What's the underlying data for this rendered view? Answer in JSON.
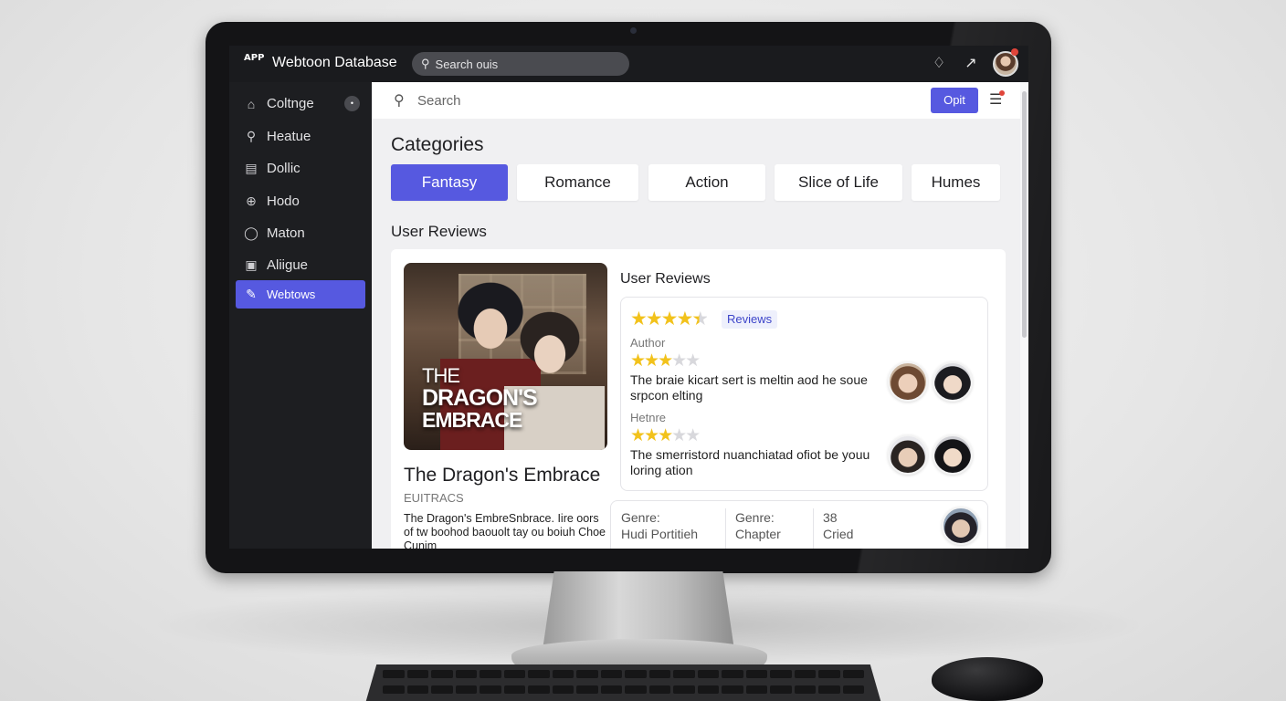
{
  "app": {
    "logo_text": "APP",
    "title": "Webtoon Database",
    "search_placeholder": "Search ouis"
  },
  "sidebar": {
    "items": [
      {
        "label": "Coltnge",
        "icon": "home-icon",
        "badge": "•"
      },
      {
        "label": "Heatue",
        "icon": "search-icon"
      },
      {
        "label": "Dollic",
        "icon": "document-icon"
      },
      {
        "label": "Hodo",
        "icon": "zoom-icon"
      },
      {
        "label": "Maton",
        "icon": "chat-icon"
      },
      {
        "label": "Aliigue",
        "icon": "image-icon"
      },
      {
        "label": "Webtows",
        "icon": "edit-icon",
        "active": true
      }
    ]
  },
  "main": {
    "search_placeholder": "Search",
    "option_button": "Opit",
    "categories_title": "Categories",
    "categories": [
      {
        "label": "Fantasy",
        "active": true
      },
      {
        "label": "Romance"
      },
      {
        "label": "Action"
      },
      {
        "label": "Slice of Life"
      },
      {
        "label": "Humes"
      }
    ],
    "reviews_section_title": "User Reviews"
  },
  "book": {
    "cover_line1": "THE",
    "cover_line2": "DRAGON'S",
    "cover_line3": "EMBRACE",
    "title": "The Dragon's Embrace",
    "subtitle": "EUITRACS",
    "description": "The Dragon's EmbreSnbrace. Iire oors of tw boohod baouolt tay ou boiuh Choe Cunim"
  },
  "reviews": {
    "title": "User Reviews",
    "tag": "Reviews",
    "overall_rating": 4.5,
    "entries": [
      {
        "author": "Author",
        "rating": 3,
        "text": "The braie kicart sert is meltin aod he soue srpcon elting"
      },
      {
        "author": "Hetnre",
        "rating": 3,
        "text": "The smerristord nuanchiatad ofiot be youu loring ation"
      }
    ]
  },
  "info": {
    "genre_label_1": "Genre:",
    "genre_value_1": "Hudi Portitieh",
    "genre_label_2": "Genre:",
    "genre_value_2": "Chapter",
    "count": "38",
    "count_label": "Cried"
  },
  "colors": {
    "accent": "#5659e0",
    "star": "#f2c21b",
    "sidebar_bg": "#1d1e21"
  }
}
